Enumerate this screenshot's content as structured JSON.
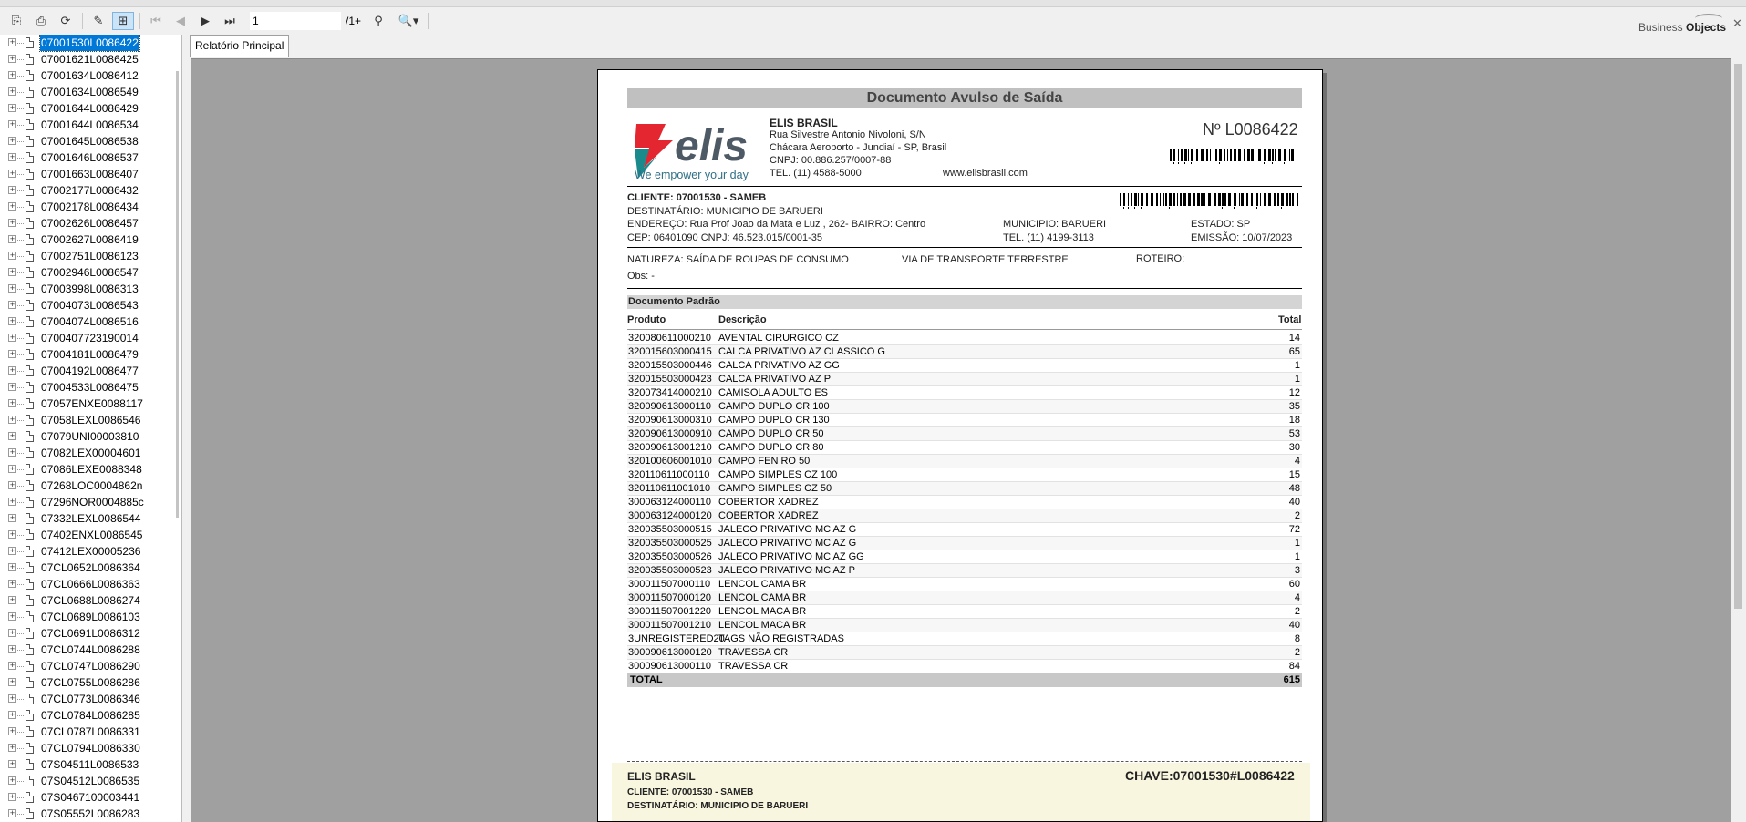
{
  "toolbar": {
    "page_value": "1",
    "page_total": "/1+",
    "brand_light": "Business ",
    "brand_bold": "Objects"
  },
  "tree": {
    "items": [
      "07001530L0086422",
      "07001621L0086425",
      "07001634L0086412",
      "07001634L0086549",
      "07001644L0086429",
      "07001644L0086534",
      "07001645L0086538",
      "07001646L0086537",
      "07001663L0086407",
      "07002177L0086432",
      "07002178L0086434",
      "07002626L0086457",
      "07002627L0086419",
      "07002751L0086123",
      "07002946L0086547",
      "07003998L0086313",
      "07004073L0086543",
      "07004074L0086516",
      "07004077231900​14",
      "07004181L0086479",
      "07004192L0086477",
      "07004533L0086475",
      "07057ENXE0088117",
      "07058LEXL0086546",
      "07079UNI00003810",
      "07082LEX00004601",
      "07086LEXE0088348",
      "07268LOC0004862n",
      "07296NOR0004885c",
      "07332LEXL0086544",
      "07402ENXL0086545",
      "07412LEX00005236",
      "07CL0652L0086364",
      "07CL0666L0086363",
      "07CL0688L0086274",
      "07CL0689L0086103",
      "07CL0691L0086312",
      "07CL0744L0086288",
      "07CL0747L0086290",
      "07CL0755L0086286",
      "07CL0773L0086346",
      "07CL0784L0086285",
      "07CL0787L0086331",
      "07CL0794L0086330",
      "07S04511L0086533",
      "07S04512L0086535",
      "07S0467100003441",
      "07S05552L0086283"
    ]
  },
  "tab": {
    "label": "Relatório Principal"
  },
  "report": {
    "title": "Documento Avulso de Saída",
    "logo_word": "elis",
    "logo_tagline": "We empower your day",
    "company_name": "ELIS BRASIL",
    "company_address": "Rua Silvestre Antonio Nivoloni, S/N",
    "company_city": "Chácara Aeroporto - Jundiaí - SP, Brasil",
    "company_cnpj": "CNPJ: 00.886.257/0007-88",
    "company_tel": "TEL. (11) 4588-5000",
    "company_site": "www.elisbrasil.com",
    "doc_number": "Nº L0086422",
    "cliente": "CLIENTE: 07001530 - SAMEB",
    "destinatario": "DESTINATÁRIO:  MUNICIPIO DE BARUERI",
    "endereco": "ENDEREÇO: Rua Prof Joao da Mata e Luz , 262- BAIRRO: Centro",
    "cep": "CEP: 06401090 CNPJ: 46.523.015/0001-35",
    "municipio": "MUNICIPIO: BARUERI",
    "tel_cliente": "TEL. (11) 4199-3113",
    "estado": "ESTADO: SP",
    "emissao": "EMISSÃO: 10/07/2023",
    "natureza": "NATUREZA: SAÍDA DE ROUPAS DE CONSUMO",
    "via": "VIA DE TRANSPORTE TERRESTRE",
    "roteiro": "ROTEIRO:",
    "obs": "Obs:  -",
    "section_title": "Documento Padrão",
    "col_produto": "Produto",
    "col_descricao": "Descrição",
    "col_total": "Total",
    "rows": [
      [
        "320080611000210",
        "AVENTAL CIRURGICO CZ",
        "14"
      ],
      [
        "320015603000415",
        "CALCA PRIVATIVO AZ CLASSICO G",
        "65"
      ],
      [
        "320015503000446",
        "CALCA PRIVATIVO AZ GG",
        "1"
      ],
      [
        "320015503000423",
        "CALCA PRIVATIVO AZ P",
        "1"
      ],
      [
        "320073414000210",
        "CAMISOLA ADULTO ES",
        "12"
      ],
      [
        "320090613000110",
        "CAMPO DUPLO CR 100",
        "35"
      ],
      [
        "320090613000310",
        "CAMPO DUPLO CR 130",
        "18"
      ],
      [
        "320090613000910",
        "CAMPO DUPLO CR 50",
        "53"
      ],
      [
        "320090613001210",
        "CAMPO DUPLO CR 80",
        "30"
      ],
      [
        "320100606001010",
        "CAMPO FEN RO 50",
        "4"
      ],
      [
        "320110611000110",
        "CAMPO SIMPLES CZ 100",
        "15"
      ],
      [
        "320110611001010",
        "CAMPO SIMPLES CZ 50",
        "48"
      ],
      [
        "300063124000110",
        "COBERTOR XADREZ",
        "40"
      ],
      [
        "300063124000120",
        "COBERTOR XADREZ",
        "2"
      ],
      [
        "320035503000515",
        "JALECO PRIVATIVO MC AZ G",
        "72"
      ],
      [
        "320035503000525",
        "JALECO PRIVATIVO MC AZ G",
        "1"
      ],
      [
        "320035503000526",
        "JALECO PRIVATIVO MC AZ GG",
        "1"
      ],
      [
        "320035503000523",
        "JALECO PRIVATIVO MC AZ P",
        "3"
      ],
      [
        "300011507000110",
        "LENCOL CAMA BR",
        "60"
      ],
      [
        "300011507000120",
        "LENCOL CAMA BR",
        "4"
      ],
      [
        "300011507001220",
        "LENCOL MACA BR",
        "2"
      ],
      [
        "300011507001210",
        "LENCOL MACA BR",
        "40"
      ],
      [
        "3UNREGISTERED20",
        "TAGS NÃO REGISTRADAS",
        "8"
      ],
      [
        "300090613000120",
        "TRAVESSA CR",
        "2"
      ],
      [
        "300090613000110",
        "TRAVESSA CR",
        "84"
      ]
    ],
    "total_label": "TOTAL",
    "total_value": "615",
    "footer_company": "ELIS BRASIL",
    "footer_chave": "CHAVE:07001530#L0086422",
    "footer_cliente": "CLIENTE: 07001530 - SAMEB",
    "footer_destinatario": "DESTINATÁRIO:  MUNICIPIO DE BARUERI"
  },
  "colors": {
    "selection": "#0078d7",
    "viewport_bg": "#a0a0a0",
    "logo_red": "#e3262f",
    "logo_teal": "#1a8a8c",
    "logo_gray": "#4d5a66"
  }
}
